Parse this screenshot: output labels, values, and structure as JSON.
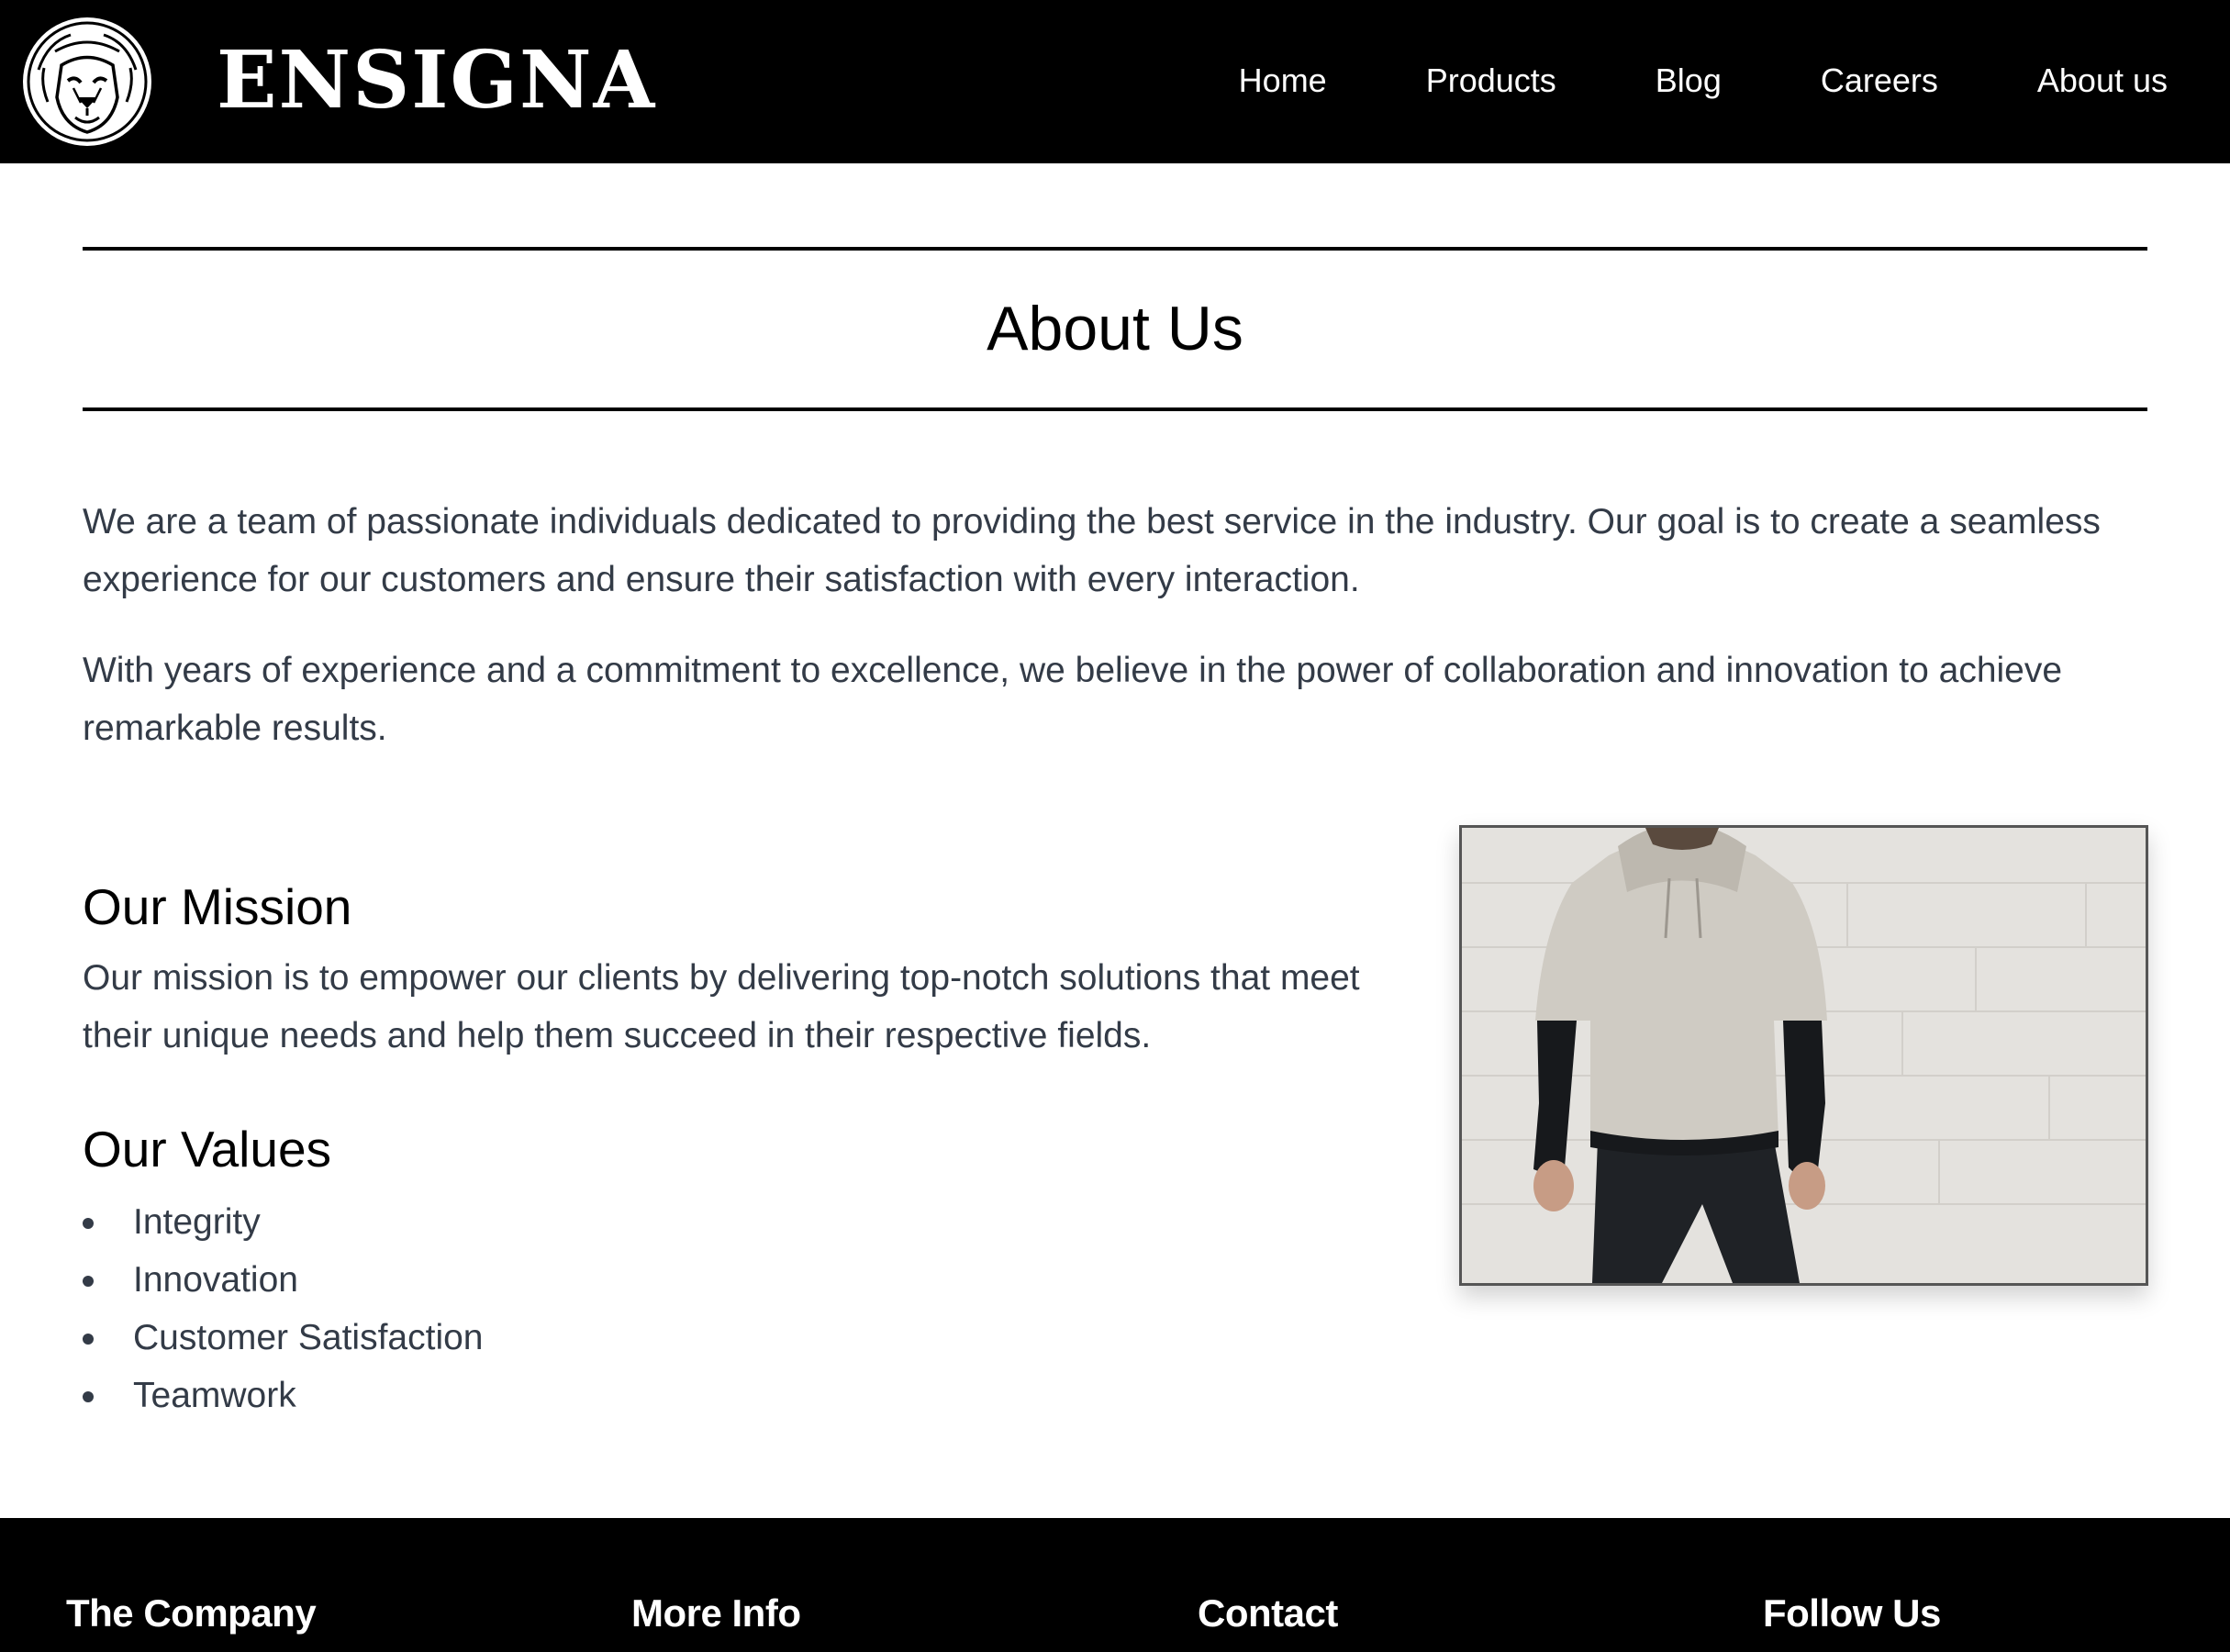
{
  "header": {
    "brand": "ENSIGNA",
    "logo_icon": "lion-head-icon",
    "nav": [
      {
        "label": "Home"
      },
      {
        "label": "Products"
      },
      {
        "label": "Blog"
      },
      {
        "label": "Careers"
      },
      {
        "label": "About us"
      }
    ]
  },
  "page": {
    "title": "About Us",
    "intro": [
      "We are a team of passionate individuals dedicated to providing the best service in the industry. Our goal is to create a seamless experience for our customers and ensure their satisfaction with every interaction.",
      "With years of experience and a commitment to excellence, we believe in the power of collaboration and innovation to achieve remarkable results."
    ],
    "mission": {
      "heading": "Our Mission",
      "text": "Our mission is to empower our clients by delivering top-notch solutions that meet their unique needs and help them succeed in their respective fields."
    },
    "values": {
      "heading": "Our Values",
      "items": [
        "Integrity",
        "Innovation",
        "Customer Satisfaction",
        "Teamwork"
      ]
    }
  },
  "footer": {
    "columns": [
      {
        "heading": "The Company"
      },
      {
        "heading": "More Info"
      },
      {
        "heading": "Contact"
      },
      {
        "heading": "Follow Us"
      }
    ]
  },
  "colors": {
    "header_bg": "#000000",
    "footer_bg": "#000000",
    "body_text": "#333b47",
    "heading_text": "#000000",
    "nav_text": "#ffffff"
  }
}
